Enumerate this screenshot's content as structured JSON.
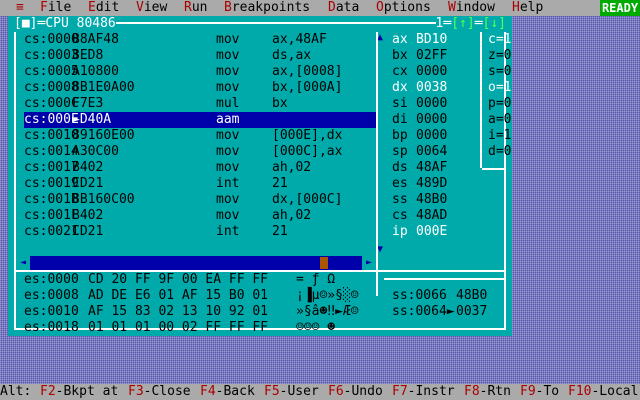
{
  "menu": {
    "system_icon": "≡",
    "items": [
      {
        "hot": "F",
        "rest": "ile"
      },
      {
        "hot": "E",
        "rest": "dit"
      },
      {
        "hot": "V",
        "rest": "iew"
      },
      {
        "hot": "R",
        "rest": "un"
      },
      {
        "hot": "B",
        "rest": "reakpoints"
      },
      {
        "hot": "D",
        "rest": "ata"
      },
      {
        "hot": "O",
        "rest": "ptions"
      },
      {
        "hot": "W",
        "rest": "indow"
      },
      {
        "hot": "H",
        "rest": "elp"
      }
    ],
    "status": "READY"
  },
  "window": {
    "close_box": "[■]",
    "title": "CPU 80486",
    "number": "1",
    "zoom_box": "[↑]",
    "resize_box": "[↓]"
  },
  "code": [
    {
      "addr": "cs:0000",
      "bytes": "B8AF48",
      "mnem": "mov",
      "ops": "ax,48AF",
      "selected": false
    },
    {
      "addr": "cs:0003",
      "bytes": "8ED8",
      "mnem": "mov",
      "ops": "ds,ax",
      "selected": false
    },
    {
      "addr": "cs:0005",
      "bytes": "A10800",
      "mnem": "mov",
      "ops": "ax,[0008]",
      "selected": false
    },
    {
      "addr": "cs:0008",
      "bytes": "8B1E0A00",
      "mnem": "mov",
      "ops": "bx,[000A]",
      "selected": false
    },
    {
      "addr": "cs:000C",
      "bytes": "F7E3",
      "mnem": "mul",
      "ops": "bx",
      "selected": false
    },
    {
      "addr": "cs:000E",
      "bytes": "►D40A",
      "mnem": "aam",
      "ops": "",
      "selected": true
    },
    {
      "addr": "cs:0010",
      "bytes": "89160E00",
      "mnem": "mov",
      "ops": "[000E],dx",
      "selected": false
    },
    {
      "addr": "cs:0014",
      "bytes": "A30C00",
      "mnem": "mov",
      "ops": "[000C],ax",
      "selected": false
    },
    {
      "addr": "cs:0017",
      "bytes": "B402",
      "mnem": "mov",
      "ops": "ah,02",
      "selected": false
    },
    {
      "addr": "cs:0019",
      "bytes": "CD21",
      "mnem": "int",
      "ops": "21",
      "selected": false
    },
    {
      "addr": "cs:001B",
      "bytes": "8B160C00",
      "mnem": "mov",
      "ops": "dx,[000C]",
      "selected": false
    },
    {
      "addr": "cs:001F",
      "bytes": "B402",
      "mnem": "mov",
      "ops": "ah,02",
      "selected": false
    },
    {
      "addr": "cs:0021",
      "bytes": "CD21",
      "mnem": "int",
      "ops": "21",
      "selected": false
    }
  ],
  "registers": [
    {
      "name": "ax",
      "value": "BD10",
      "changed": true
    },
    {
      "name": "bx",
      "value": "02FF",
      "changed": false
    },
    {
      "name": "cx",
      "value": "0000",
      "changed": false
    },
    {
      "name": "dx",
      "value": "0038",
      "changed": true
    },
    {
      "name": "si",
      "value": "0000",
      "changed": false
    },
    {
      "name": "di",
      "value": "0000",
      "changed": false
    },
    {
      "name": "bp",
      "value": "0000",
      "changed": false
    },
    {
      "name": "sp",
      "value": "0064",
      "changed": false
    },
    {
      "name": "ds",
      "value": "48AF",
      "changed": false
    },
    {
      "name": "es",
      "value": "489D",
      "changed": false
    },
    {
      "name": "ss",
      "value": "48B0",
      "changed": false
    },
    {
      "name": "cs",
      "value": "48AD",
      "changed": false
    },
    {
      "name": "ip",
      "value": "000E",
      "changed": true
    }
  ],
  "flags": [
    {
      "text": "c=1",
      "changed": true
    },
    {
      "text": "z=0",
      "changed": false
    },
    {
      "text": "s=0",
      "changed": false
    },
    {
      "text": "o=1",
      "changed": true
    },
    {
      "text": "p=0",
      "changed": false
    },
    {
      "text": "a=0",
      "changed": false
    },
    {
      "text": "i=1",
      "changed": false
    },
    {
      "text": "d=0",
      "changed": false
    }
  ],
  "dump": [
    {
      "addr": "es:0000",
      "bytes": "CD 20 FF 9F 00 EA FF FF",
      "ascii": "= ƒ Ω"
    },
    {
      "addr": "es:0008",
      "bytes": "AD DE E6 01 AF 15 B0 01",
      "ascii": "¡▐µ☺»§░☺"
    },
    {
      "addr": "es:0010",
      "bytes": "AF 15 83 02 13 10 92 01",
      "ascii": "»§â☻‼►Æ☺"
    },
    {
      "addr": "es:0018",
      "bytes": "01 01 01 00 02 FF FF FF",
      "ascii": "☺☺☺ ☻"
    }
  ],
  "stack": [
    {
      "addr": "ss:0066",
      "value": "48B0"
    },
    {
      "addr": "ss:0064►",
      "value": "0037"
    }
  ],
  "status": {
    "prefix": "Alt:",
    "keys": [
      {
        "key": "F2",
        "label": "-Bkpt at"
      },
      {
        "key": "F3",
        "label": "-Close"
      },
      {
        "key": "F4",
        "label": "-Back"
      },
      {
        "key": "F5",
        "label": "-User"
      },
      {
        "key": "F6",
        "label": "-Undo"
      },
      {
        "key": "F7",
        "label": "-Instr"
      },
      {
        "key": "F8",
        "label": "-Rtn"
      },
      {
        "key": "F9",
        "label": "-To"
      },
      {
        "key": "F10",
        "label": "-Local"
      }
    ]
  },
  "colors": {
    "desktop": "#5454a8",
    "window": "#00aaaa",
    "selection": "#0000aa",
    "menu_bg": "#aaaaaa",
    "hotkey": "#aa0000",
    "ready": "#00aa00"
  }
}
